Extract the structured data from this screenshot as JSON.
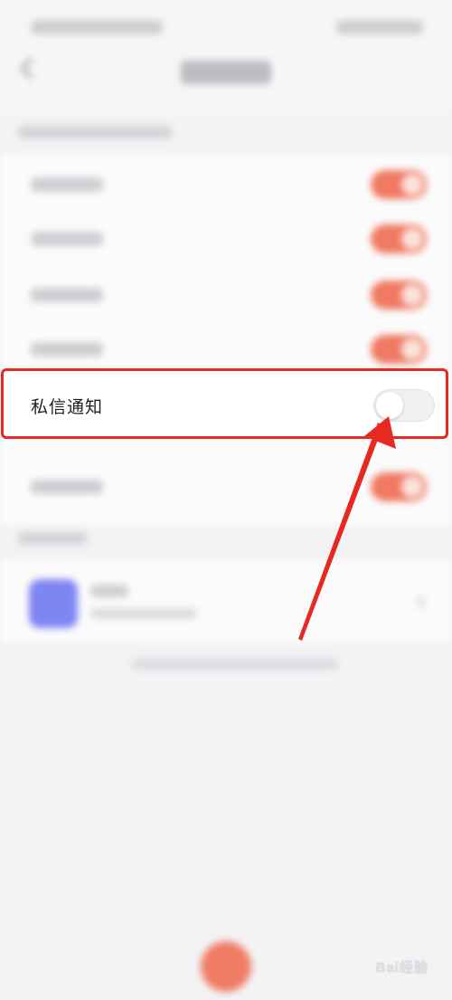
{
  "highlighted_row": {
    "label": "私信通知",
    "toggle_state": "off"
  },
  "blurred_rows_toggle_state": "on",
  "colors": {
    "highlight_border": "#e62a22",
    "toggle_on": "#f07a62",
    "app_icon": "#7e86f2",
    "background": "#f3f3f5"
  },
  "watermark": {
    "text": "Bai经验"
  }
}
